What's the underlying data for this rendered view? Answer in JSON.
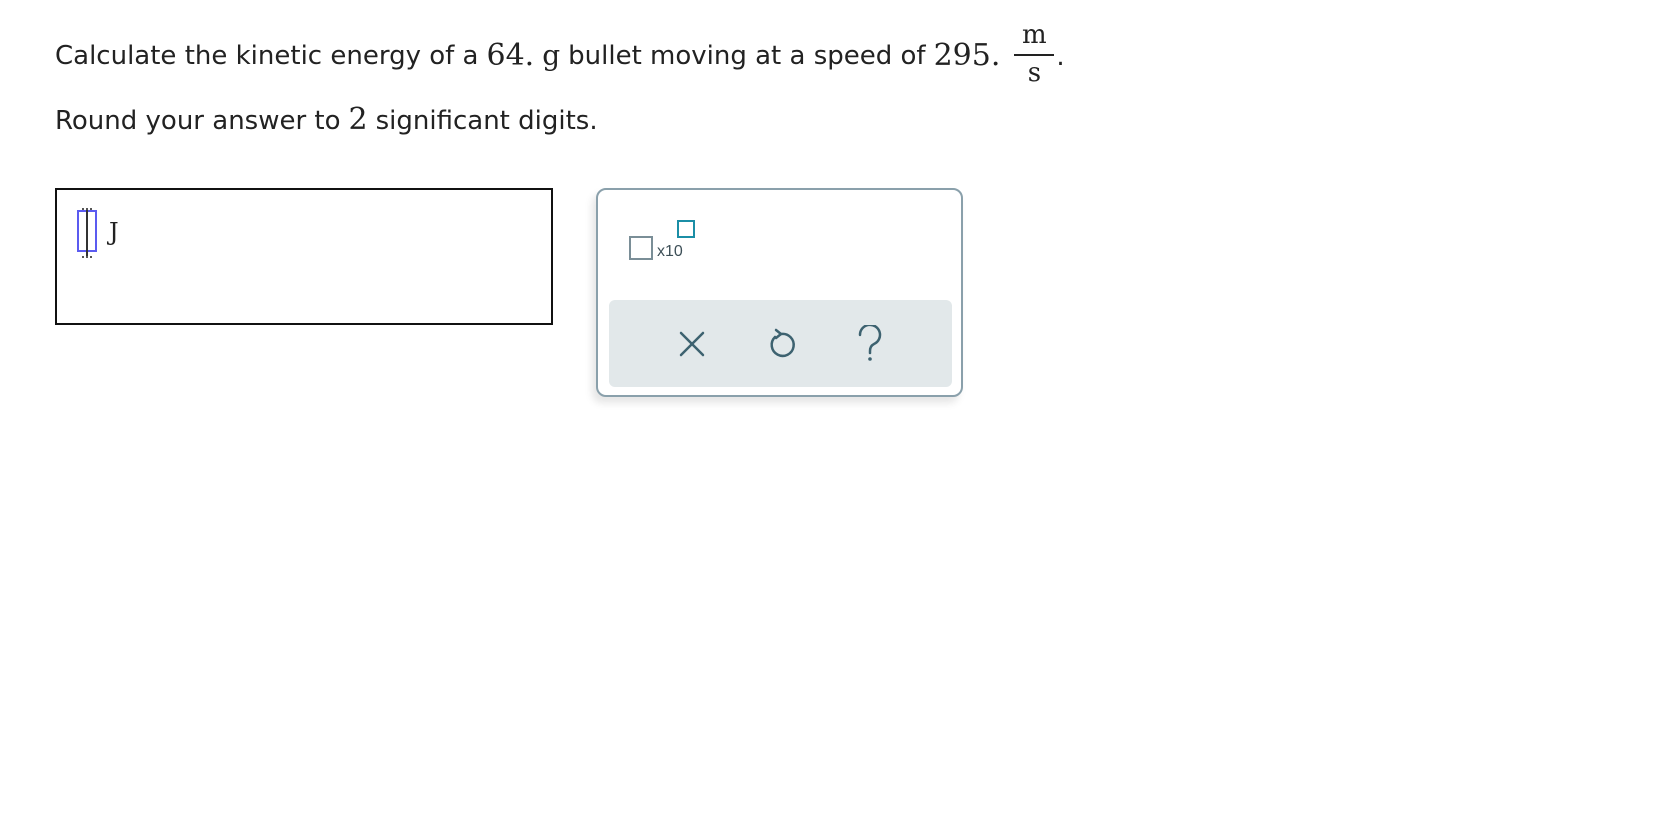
{
  "question": {
    "line1": {
      "part1": "Calculate the kinetic energy of a",
      "mass_value": "64.",
      "mass_unit": "g",
      "part2": "bullet moving at a speed of",
      "speed_value": "295.",
      "speed_unit_numerator": "m",
      "speed_unit_denominator": "s",
      "end_punct": "."
    },
    "line2": {
      "part1": "Round your answer to",
      "digits": "2",
      "part2": "significant digits."
    }
  },
  "answer": {
    "value": "",
    "unit": "J"
  },
  "palette": {
    "sci_notation_label": "x10",
    "tools": {
      "clear_icon": "x-icon",
      "undo_icon": "undo-icon",
      "help_icon": "help-icon"
    },
    "colors": {
      "border": "#8aa0ab",
      "toolbar_bg": "#e2e8ea",
      "icon": "#3d6270",
      "exponent_box": "#1b8ea6"
    }
  }
}
